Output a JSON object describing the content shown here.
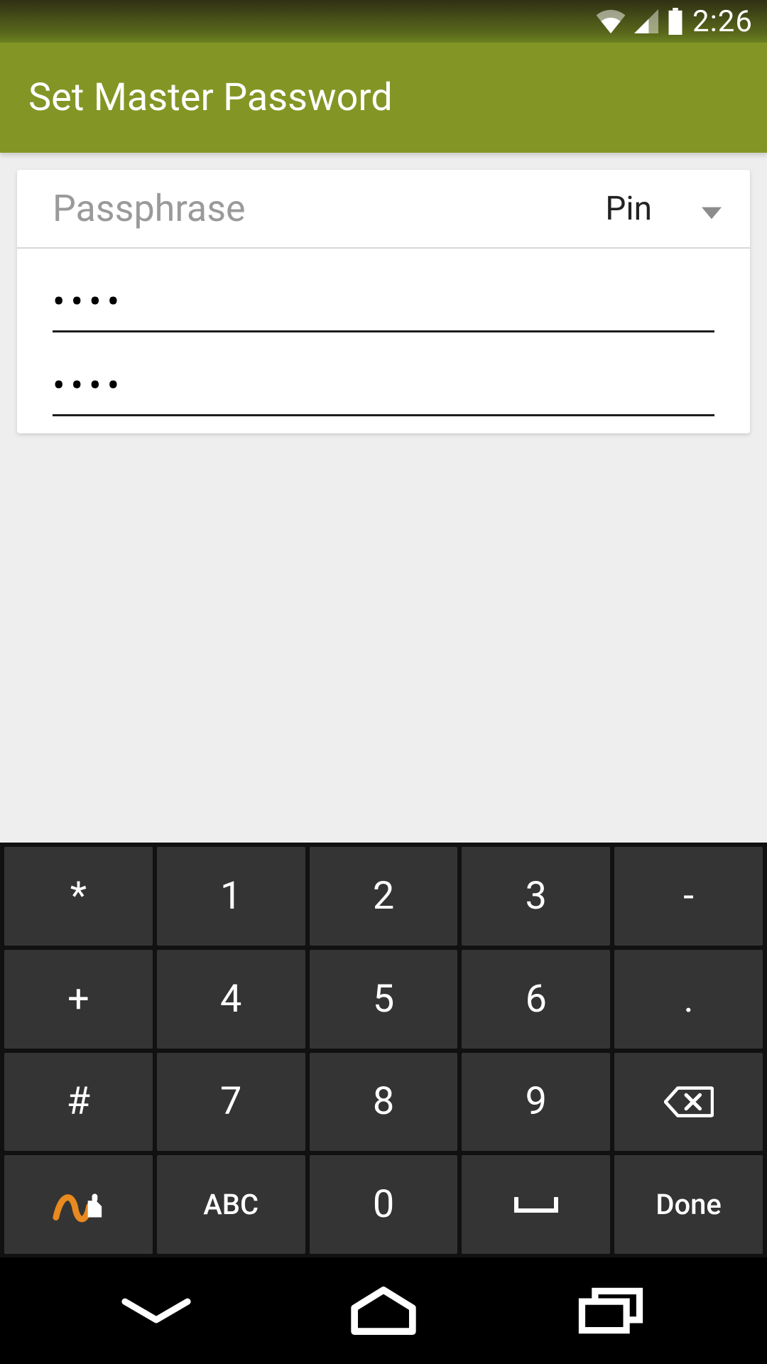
{
  "status": {
    "time": "2:26"
  },
  "appbar": {
    "title": "Set Master Password"
  },
  "card": {
    "label": "Passphrase",
    "dropdown_value": "Pin",
    "pin1_value": "••••",
    "pin2_value": "••••"
  },
  "keyboard": {
    "rows": [
      [
        "*",
        "1",
        "2",
        "3",
        "-"
      ],
      [
        "+",
        "4",
        "5",
        "6",
        "."
      ],
      [
        "#",
        "7",
        "8",
        "9",
        "⌫"
      ],
      [
        "swype",
        "ABC",
        "0",
        "␣",
        "Done"
      ]
    ],
    "k_star": "*",
    "k_1": "1",
    "k_2": "2",
    "k_3": "3",
    "k_minus": "-",
    "k_plus": "+",
    "k_4": "4",
    "k_5": "5",
    "k_6": "6",
    "k_dot": ".",
    "k_hash": "#",
    "k_7": "7",
    "k_8": "8",
    "k_9": "9",
    "k_abc": "ABC",
    "k_0": "0",
    "k_done": "Done"
  }
}
